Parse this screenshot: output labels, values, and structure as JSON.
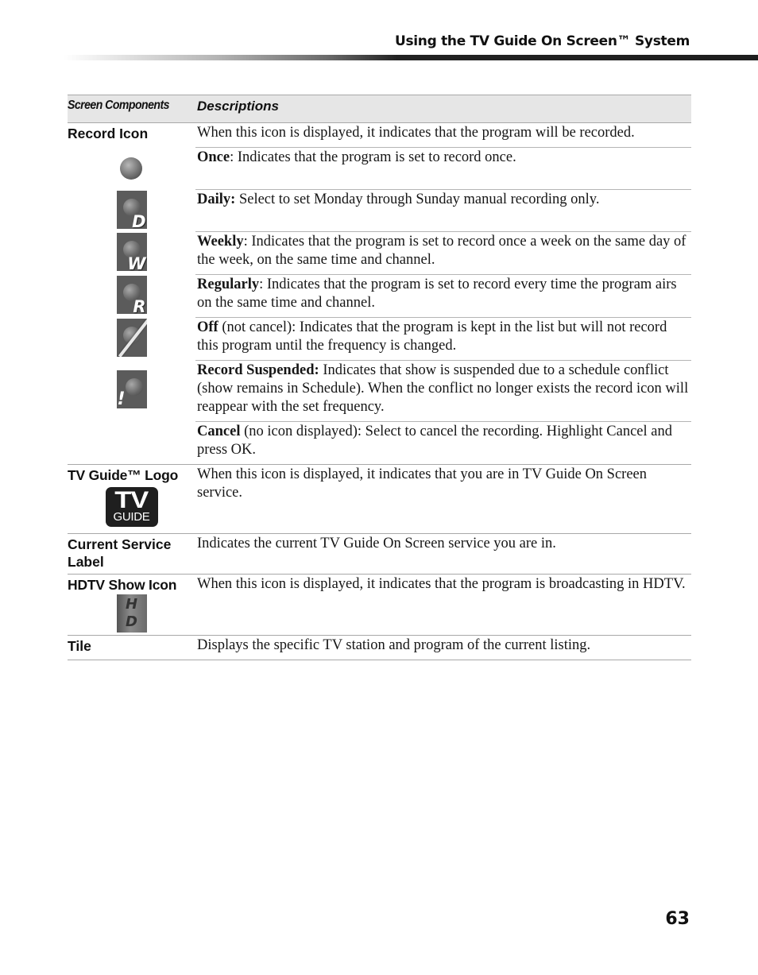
{
  "header": {
    "title": "Using the TV Guide On Screen™ System"
  },
  "table": {
    "columns": [
      "Screen Components",
      "Descriptions"
    ],
    "record_icon": {
      "component": "Record Icon",
      "description": "When this icon is displayed, it indicates that the program will be recorded.",
      "options": [
        {
          "icon": "record-once-icon",
          "term": "Once",
          "text": ": Indicates that the program is set to record once."
        },
        {
          "icon": "record-daily-icon",
          "icon_letter": "D",
          "term": "Daily:",
          "text": " Select to set Monday through Sunday manual recording only."
        },
        {
          "icon": "record-weekly-icon",
          "icon_letter": "W",
          "term": "Weekly",
          "text": ": Indicates that the program is set to record once a week on the same day of the week, on the same time and channel."
        },
        {
          "icon": "record-regularly-icon",
          "icon_letter": "R",
          "term": "Regularly",
          "text": ": Indicates that the program is set to record  every time the program airs on the same time and channel."
        },
        {
          "icon": "record-off-icon",
          "term": "Off",
          "text": " (not cancel): Indicates that the program is kept in the list but will not record this program until the frequency is changed."
        },
        {
          "icon": "record-suspended-icon",
          "icon_letter": "!",
          "term": "Record Suspended:",
          "text": " Indicates that show is suspended due to a schedule conflict (show remains in Schedule). When the conflict no longer exists the record icon will reappear with the set frequency."
        },
        {
          "icon": "",
          "term": "Cancel",
          "text": " (no icon displayed): Select to cancel the recording. Highlight Cancel and press OK."
        }
      ]
    },
    "tvguide_logo": {
      "component": "TV Guide™ Logo",
      "logo_top": "TV",
      "logo_bottom": "GUIDE",
      "description": "When this icon is displayed, it indicates that you are in TV Guide On Screen service."
    },
    "current_service_label": {
      "component": "Current Service Label",
      "description": "Indicates the current TV Guide On Screen service you are in."
    },
    "hdtv_show_icon": {
      "component": "HDTV Show Icon",
      "icon_top": "H",
      "icon_bottom": "D",
      "description": "When this icon is displayed, it indicates that the program is broadcasting in HDTV."
    },
    "tile": {
      "component": "Tile",
      "description": "Displays the specific TV station and program of the current listing."
    }
  },
  "footer": {
    "page_number": "63"
  }
}
